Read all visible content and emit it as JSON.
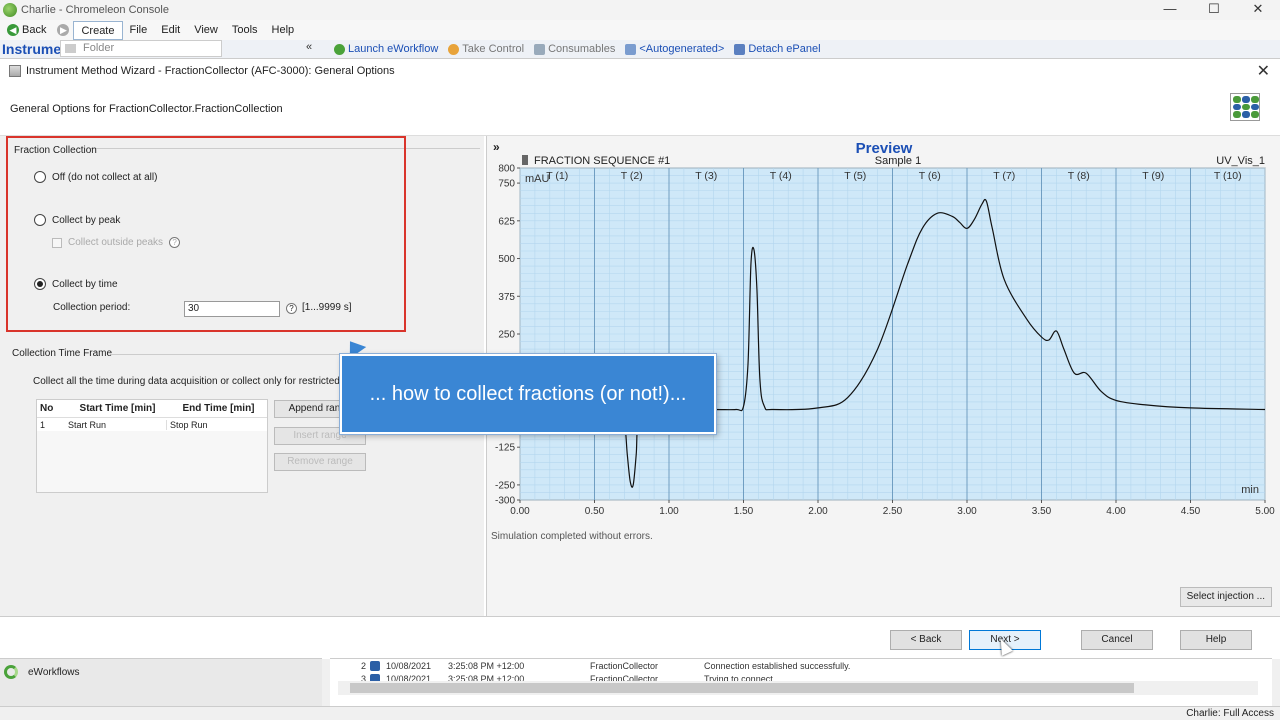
{
  "window": {
    "title": "Charlie - Chromeleon Console",
    "controls": [
      "—",
      "☐",
      "✕"
    ]
  },
  "menubar": {
    "back": "Back",
    "items": [
      "Create",
      "File",
      "Edit",
      "View",
      "Tools",
      "Help"
    ]
  },
  "toolbar": {
    "instruments_label": "Instruments",
    "folder_placeholder": "Folder",
    "collapse": "«",
    "launch_eworkflow": "Launch eWorkflow",
    "take_control": "Take Control",
    "consumables": "Consumables",
    "autogenerated": "<Autogenerated>",
    "detach_epanel": "Detach ePanel"
  },
  "dialog": {
    "title": "Instrument Method Wizard - FractionCollector (AFC-3000): General Options",
    "close": "✕",
    "subtitle": "General Options for FractionCollector.FractionCollection",
    "fraction_collection": {
      "title": "Fraction Collection",
      "opt_off": "Off (do not collect at all)",
      "opt_peak": "Collect by peak",
      "collect_outside": "Collect outside peaks",
      "opt_time": "Collect by time",
      "period_label": "Collection period:",
      "period_value": "30",
      "period_range": "[1...9999 s]"
    },
    "time_frame": {
      "title": "Collection Time Frame",
      "desc": "Collect all the time during data acquisition or collect only for restricted time ranges.",
      "headers": [
        "No",
        "Start Time [min]",
        "End Time [min]"
      ],
      "rows": [
        {
          "no": "1",
          "start": "Start Run",
          "end": "Stop Run"
        }
      ],
      "append": "Append range",
      "insert": "Insert range",
      "remove": "Remove range"
    },
    "preview": {
      "title": "Preview",
      "chevron": "»",
      "sequence": "FRACTION SEQUENCE #1",
      "sample": "Sample 1",
      "channel": "UV_Vis_1",
      "sim_msg": "Simulation completed without errors.",
      "select_injection": "Select injection ..."
    },
    "buttons": {
      "back": "< Back",
      "next": "Next >",
      "cancel": "Cancel",
      "help": "Help"
    }
  },
  "callout": "... how to collect fractions (or not!)...",
  "bottom": {
    "eworkflows": "eWorkflows",
    "log": [
      {
        "n": "2",
        "date": "10/08/2021",
        "time": "3:25:08 PM +12:00",
        "src": "FractionCollector",
        "msg": "Connection established successfully."
      },
      {
        "n": "3",
        "date": "10/08/2021",
        "time": "3:25:08 PM +12:00",
        "src": "FractionCollector",
        "msg": "Trying to connect..."
      }
    ],
    "status": "Charlie: Full Access"
  },
  "chart_data": {
    "type": "line",
    "ylabel": "mAU",
    "xlabel": "min",
    "xlim": [
      0,
      5
    ],
    "ylim": [
      -300,
      800
    ],
    "x_ticks": [
      0,
      0.5,
      1.0,
      1.5,
      2.0,
      2.5,
      3.0,
      3.5,
      4.0,
      4.5,
      5.0
    ],
    "x_tick_labels": [
      "0.00",
      "0.50",
      "1.00",
      "1.50",
      "2.00",
      "2.50",
      "3.00",
      "3.50",
      "4.00",
      "4.50",
      "5.00"
    ],
    "y_ticks": [
      800,
      750,
      625,
      500,
      375,
      250,
      -125,
      -250,
      -300
    ],
    "fraction_labels": [
      "T (1)",
      "T (2)",
      "T (3)",
      "T (4)",
      "T (5)",
      "T (6)",
      "T (7)",
      "T (8)",
      "T (9)",
      "T (10)"
    ],
    "fraction_period_min": 0.5,
    "series": [
      {
        "x": [
          0,
          0.6,
          0.65,
          0.7,
          0.72,
          0.74,
          0.76,
          0.78,
          0.8,
          0.9,
          1.0,
          1.3,
          1.45,
          1.5,
          1.53,
          1.55,
          1.57,
          1.59,
          1.61,
          1.64,
          1.7,
          2.0,
          2.2,
          2.4,
          2.6,
          2.7,
          2.8,
          2.9,
          2.95,
          3.0,
          3.05,
          3.1,
          3.13,
          3.17,
          3.25,
          3.4,
          3.5,
          3.55,
          3.6,
          3.65,
          3.72,
          3.8,
          3.9,
          4.0,
          4.2,
          4.5,
          5.0
        ],
        "y": [
          0,
          0,
          0,
          -40,
          -150,
          -240,
          -250,
          -150,
          -20,
          0,
          0,
          0,
          0,
          10,
          150,
          480,
          530,
          400,
          100,
          10,
          0,
          5,
          40,
          200,
          480,
          600,
          650,
          640,
          620,
          600,
          630,
          680,
          690,
          600,
          430,
          300,
          240,
          230,
          260,
          200,
          120,
          120,
          60,
          30,
          15,
          5,
          0
        ]
      }
    ]
  }
}
